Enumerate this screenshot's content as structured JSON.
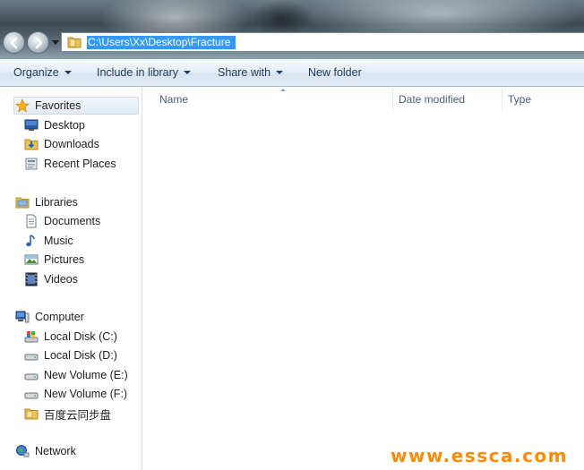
{
  "window": {
    "address_path": "C:\\Users\\Xx\\Desktop\\Fracture"
  },
  "toolbar": {
    "organize": "Organize",
    "include_in_library": "Include in library",
    "share_with": "Share with",
    "new_folder": "New folder"
  },
  "nav": {
    "favorites": {
      "label": "Favorites",
      "items": [
        "Desktop",
        "Downloads",
        "Recent Places"
      ]
    },
    "libraries": {
      "label": "Libraries",
      "items": [
        "Documents",
        "Music",
        "Pictures",
        "Videos"
      ]
    },
    "computer": {
      "label": "Computer",
      "items": [
        "Local Disk (C:)",
        "Local Disk (D:)",
        "New Volume (E:)",
        "New Volume (F:)",
        "百度云同步盘"
      ]
    },
    "network": {
      "label": "Network"
    }
  },
  "columns": {
    "name": "Name",
    "date_modified": "Date modified",
    "type": "Type"
  },
  "watermark": "www.essca.com",
  "colors": {
    "address_selection": "#3399ff",
    "toolbar_text": "#1e395b",
    "watermark": "#ff8c00"
  }
}
